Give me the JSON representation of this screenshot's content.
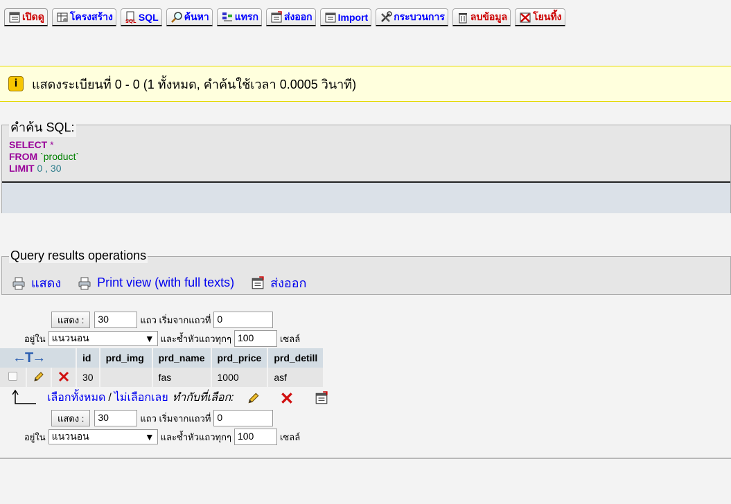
{
  "tabs": [
    {
      "label": "เปิดดู",
      "icon": "browse-icon",
      "active": true
    },
    {
      "label": "โครงสร้าง",
      "icon": "structure-icon"
    },
    {
      "label": "SQL",
      "icon": "sql-icon"
    },
    {
      "label": "ค้นหา",
      "icon": "search-icon"
    },
    {
      "label": "แทรก",
      "icon": "insert-icon"
    },
    {
      "label": "ส่งออก",
      "icon": "export-icon"
    },
    {
      "label": "Import",
      "icon": "import-icon"
    },
    {
      "label": "กระบวนการ",
      "icon": "operations-icon"
    },
    {
      "label": "ลบข้อมูล",
      "icon": "empty-icon"
    },
    {
      "label": "โยนทิ้ง",
      "icon": "drop-icon"
    }
  ],
  "notice": {
    "icon": "info-icon",
    "text": "แสดงระเบียนที่ 0 - 0 (1 ทั้งหมด, คำค้นใช้เวลา 0.0005 วินาที)"
  },
  "sql_query": {
    "legend": "คำค้น SQL:",
    "kw_select": "SELECT",
    "star": "*",
    "kw_from": "FROM",
    "table": "`product`",
    "kw_limit": "LIMIT",
    "limit_start": "0",
    "comma": ",",
    "limit_count": "30"
  },
  "query_ops": {
    "legend": "Query results operations",
    "print_label": "แสดง",
    "print_full_label": "Print view (with full texts)",
    "export_label": "ส่งออก"
  },
  "nav": {
    "show_button": "แสดง :",
    "rows_value": "30",
    "rows_label": "แถว เริ่มจากแถวที่",
    "start_value": "0",
    "in_label": "อยู่ใน",
    "mode_value": "แนวนอน",
    "repeat_label": "และซ้ำหัวแถวทุกๆ",
    "repeat_value": "100",
    "cells_label": "เซลล์"
  },
  "table": {
    "columns": [
      "id",
      "prd_img",
      "prd_name",
      "prd_price",
      "prd_detill"
    ],
    "rows": [
      {
        "id": "30",
        "prd_img": "",
        "prd_name": "fas",
        "prd_price": "1000",
        "prd_detill": "asf"
      }
    ],
    "arrows": "←T→"
  },
  "bulk": {
    "check_all": "เลือกทั้งหมด",
    "sep": "/",
    "uncheck_all": "ไม่เลือกเลย",
    "with_selected": "ทำกับที่เลือก:"
  },
  "colors": {
    "tab_link": "#235a81",
    "link": "#0000ee",
    "notice_bg": "#ffffdd",
    "table_header": "#d3dce3",
    "sql_keyword": "#990099"
  }
}
